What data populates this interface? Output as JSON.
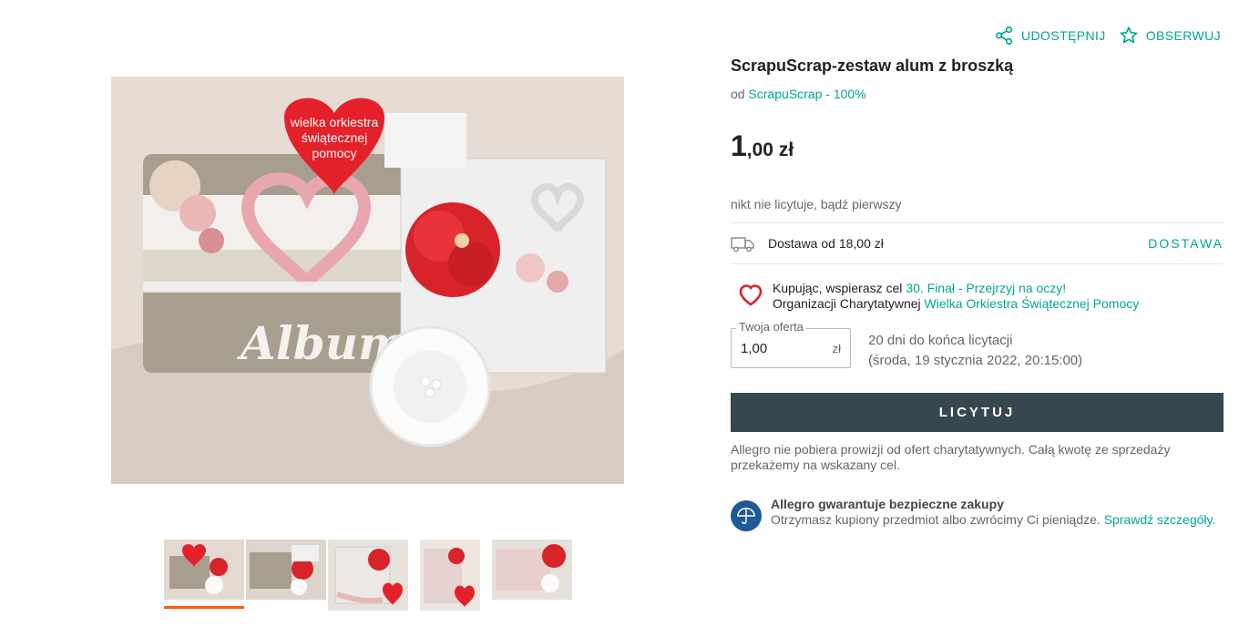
{
  "actions": {
    "share": "UDOSTĘPNIJ",
    "watch": "OBSERWUJ"
  },
  "product": {
    "title": "ScrapuScrap-zestaw alum z broszką",
    "seller_prefix": "od",
    "seller": "ScrapuScrap - 100%",
    "price_int": "1",
    "price_dec": ",00 zł",
    "bids_text": "nikt nie licytuje, bądź pierwszy"
  },
  "delivery": {
    "text": "Dostawa od 18,00 zł",
    "link": "DOSTAWA"
  },
  "charity": {
    "line1_prefix": "Kupując, wspierasz cel",
    "line1_link": "30. Finał - Przejrzyj na oczy!",
    "line2_prefix": "Organizacji Charytatywnej",
    "line2_link": "Wielka Orkiestra Świątecznej Pomocy"
  },
  "offer": {
    "legend": "Twoja oferta",
    "value": "1,00",
    "currency": "zł"
  },
  "ends": {
    "line1": "20 dni do końca licytacji",
    "line2": "(środa, 19 stycznia 2022, 20:15:00)"
  },
  "bid_button": "LICYTUJ",
  "note": "Allegro nie pobiera prowizji od ofert charytatywnych. Całą kwotę ze sprzedaży przekażemy na wskazany cel.",
  "guarantee": {
    "title": "Allegro gwarantuje bezpieczne zakupy",
    "text": "Otrzymasz kupiony przedmiot albo zwrócimy Ci pieniądze.",
    "link": "Sprawdź szczegóły."
  },
  "image": {
    "badge_text": "wielka orkiestra świątecznej pomocy",
    "album_text": "Album"
  },
  "colors": {
    "accent": "#00a790",
    "button": "#37474f",
    "active_thumb": "#ff5a00",
    "heart": "#e4202b"
  }
}
